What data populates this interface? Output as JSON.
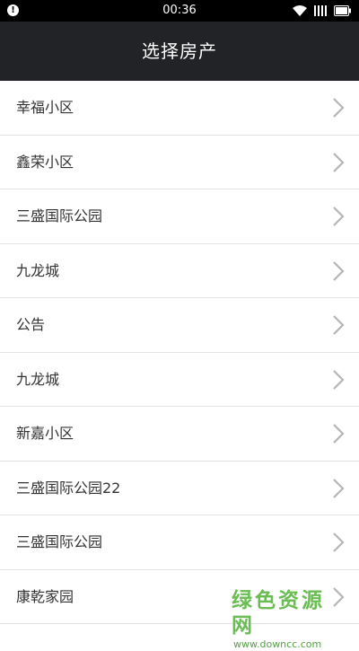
{
  "status_bar": {
    "time": "00:36",
    "icons": [
      "alert-icon",
      "wifi-icon",
      "signal-icon",
      "battery-icon"
    ]
  },
  "header": {
    "title": "选择房产"
  },
  "estates": [
    {
      "label": "幸福小区"
    },
    {
      "label": "鑫荣小区"
    },
    {
      "label": "三盛国际公园"
    },
    {
      "label": "九龙城"
    },
    {
      "label": "公告"
    },
    {
      "label": "九龙城"
    },
    {
      "label": "新嘉小区"
    },
    {
      "label": "三盛国际公园22"
    },
    {
      "label": "三盛国际公园"
    },
    {
      "label": "康乾家园"
    }
  ],
  "watermark": {
    "name": "绿色资源网",
    "url": "www.downcc.com"
  },
  "colors": {
    "status_bar_bg": "#000000",
    "header_bg": "#222326",
    "list_bg": "#ffffff",
    "divider": "#e3e3e3",
    "chevron": "#b5b5b5",
    "watermark": "#4fb234"
  }
}
